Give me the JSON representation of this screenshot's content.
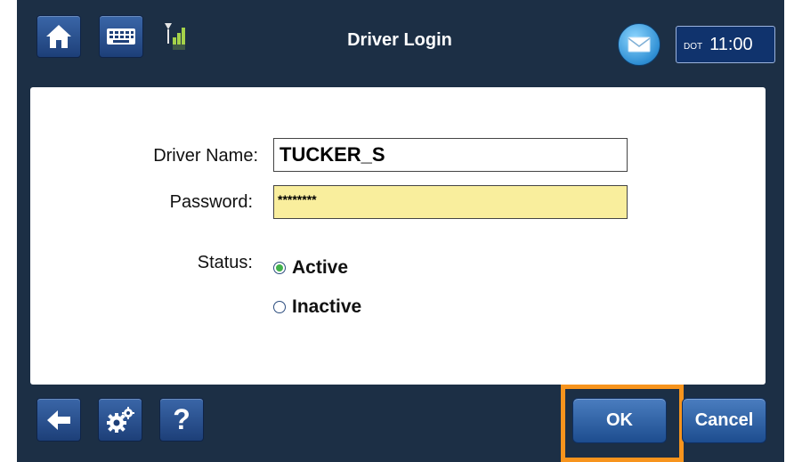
{
  "header": {
    "title": "Driver Login",
    "clock_prefix": "DOT",
    "time": "11:00"
  },
  "form": {
    "driver_name_label": "Driver Name:",
    "driver_name_value": "TUCKER_S",
    "password_label": "Password:",
    "password_value": "********",
    "status_label": "Status:",
    "status_options": [
      {
        "label": "Active",
        "selected": true
      },
      {
        "label": "Inactive",
        "selected": false
      }
    ]
  },
  "footer": {
    "help_label": "?",
    "ok_label": "OK",
    "cancel_label": "Cancel"
  },
  "colors": {
    "background": "#1c2f45",
    "button_blue": "#2a5ea6",
    "password_field": "#f9ee9d",
    "highlight_orange": "#f7941d",
    "radio_selected": "#41b14b"
  },
  "icons": {
    "home": "home-icon",
    "keyboard": "keyboard-icon",
    "signal": "signal-strength-icon",
    "message": "envelope-icon",
    "back": "arrow-left-icon",
    "settings": "gears-icon"
  }
}
